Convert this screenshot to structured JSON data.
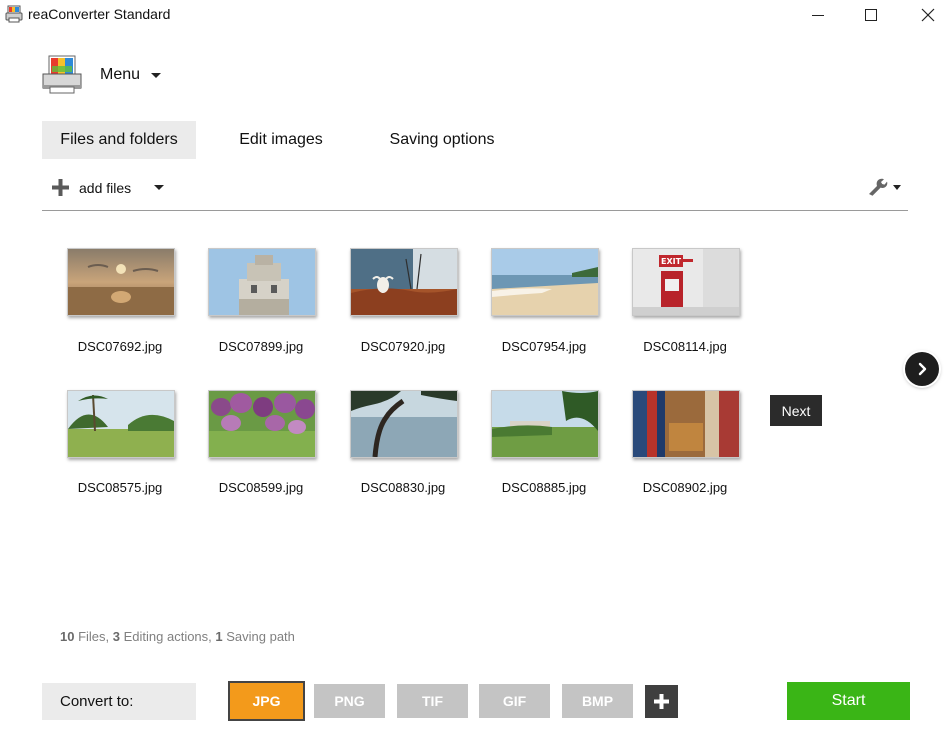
{
  "window": {
    "title": "reaConverter Standard"
  },
  "menu": {
    "label": "Menu"
  },
  "tabs": [
    {
      "label": "Files and folders",
      "active": true
    },
    {
      "label": "Edit images",
      "active": false
    },
    {
      "label": "Saving options",
      "active": false
    }
  ],
  "toolbar": {
    "add_files_label": "add files",
    "settings_icon": "wrench-icon"
  },
  "files": [
    {
      "name": "DSC07692.jpg"
    },
    {
      "name": "DSC07899.jpg"
    },
    {
      "name": "DSC07920.jpg"
    },
    {
      "name": "DSC07954.jpg"
    },
    {
      "name": "DSC08114.jpg"
    },
    {
      "name": "DSC08575.jpg"
    },
    {
      "name": "DSC08599.jpg"
    },
    {
      "name": "DSC08830.jpg"
    },
    {
      "name": "DSC08885.jpg"
    },
    {
      "name": "DSC08902.jpg"
    }
  ],
  "next_tooltip": "Next",
  "summary": {
    "files_count": "10",
    "files_label": " Files, ",
    "actions_count": "3",
    "actions_label": " Editing actions, ",
    "paths_count": "1",
    "paths_label": " Saving path"
  },
  "convert": {
    "label": "Convert to:",
    "formats": [
      {
        "label": "JPG",
        "selected": true
      },
      {
        "label": "PNG",
        "selected": false
      },
      {
        "label": "TIF",
        "selected": false
      },
      {
        "label": "GIF",
        "selected": false
      },
      {
        "label": "BMP",
        "selected": false
      }
    ]
  },
  "start_label": "Start",
  "colors": {
    "selected_format": "#f39a1b",
    "start_button": "#3ab516",
    "tab_active_bg": "#ebebeb"
  }
}
